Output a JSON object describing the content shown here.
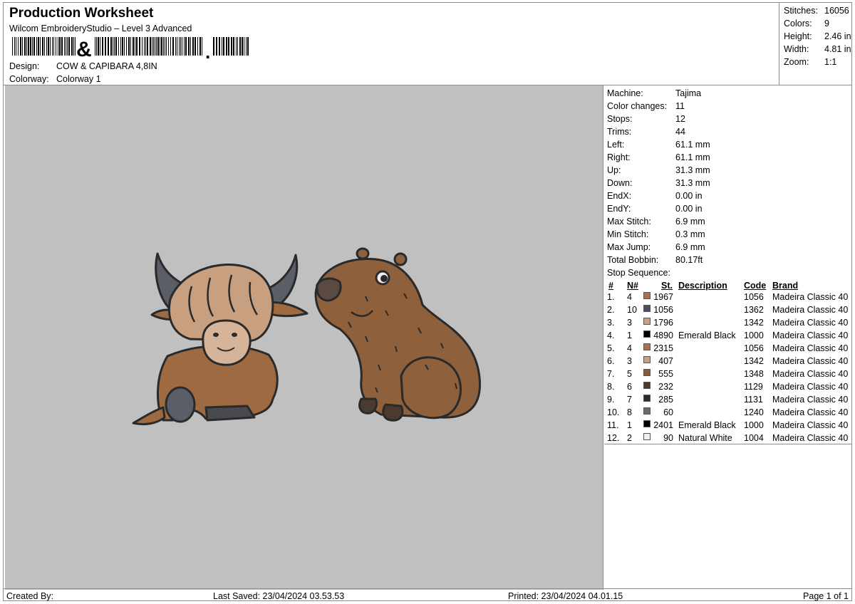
{
  "header": {
    "title": "Production Worksheet",
    "subtitle": "Wilcom EmbroideryStudio – Level 3 Advanced",
    "design_label": "Design:",
    "design_value": "COW  & CAPIBARA 4,8IN",
    "colorway_label": "Colorway:",
    "colorway_value": "Colorway 1"
  },
  "summary": [
    {
      "label": "Stitches:",
      "value": "16056"
    },
    {
      "label": "Colors:",
      "value": "9"
    },
    {
      "label": "Height:",
      "value": "2.46 in"
    },
    {
      "label": "Width:",
      "value": "4.81 in"
    },
    {
      "label": "Zoom:",
      "value": "1:1"
    }
  ],
  "machine_info": [
    {
      "label": "Machine:",
      "value": "Tajima"
    },
    {
      "label": "Color changes:",
      "value": "11"
    },
    {
      "label": "Stops:",
      "value": "12"
    },
    {
      "label": "Trims:",
      "value": "44"
    },
    {
      "label": "Left:",
      "value": "61.1 mm"
    },
    {
      "label": "Right:",
      "value": "61.1 mm"
    },
    {
      "label": "Up:",
      "value": "31.3 mm"
    },
    {
      "label": "Down:",
      "value": "31.3 mm"
    },
    {
      "label": "EndX:",
      "value": "0.00 in"
    },
    {
      "label": "EndY:",
      "value": "0.00 in"
    },
    {
      "label": "Max Stitch:",
      "value": "6.9 mm"
    },
    {
      "label": "Min Stitch:",
      "value": "0.3 mm"
    },
    {
      "label": "Max Jump:",
      "value": "6.9 mm"
    },
    {
      "label": "Total Bobbin:",
      "value": "80.17ft"
    }
  ],
  "stop_sequence": {
    "title": "Stop Sequence:",
    "columns": {
      "idx": "#",
      "needle": "N#",
      "stitches": "St.",
      "description": "Description",
      "code": "Code",
      "brand": "Brand"
    },
    "rows": [
      {
        "idx": "1.",
        "needle": "4",
        "color": "#a87050",
        "stitches": "1967",
        "description": "",
        "code": "1056",
        "brand": "Madeira Classic 40"
      },
      {
        "idx": "2.",
        "needle": "10",
        "color": "#4e4e5e",
        "stitches": "1056",
        "description": "",
        "code": "1362",
        "brand": "Madeira Classic 40"
      },
      {
        "idx": "3.",
        "needle": "3",
        "color": "#c8a08a",
        "stitches": "1796",
        "description": "",
        "code": "1342",
        "brand": "Madeira Classic 40"
      },
      {
        "idx": "4.",
        "needle": "1",
        "color": "#000000",
        "stitches": "4890",
        "description": "Emerald Black",
        "code": "1000",
        "brand": "Madeira Classic 40"
      },
      {
        "idx": "5.",
        "needle": "4",
        "color": "#a87050",
        "stitches": "2315",
        "description": "",
        "code": "1056",
        "brand": "Madeira Classic 40"
      },
      {
        "idx": "6.",
        "needle": "3",
        "color": "#c8a08a",
        "stitches": "407",
        "description": "",
        "code": "1342",
        "brand": "Madeira Classic 40"
      },
      {
        "idx": "7.",
        "needle": "5",
        "color": "#8a5a3a",
        "stitches": "555",
        "description": "",
        "code": "1348",
        "brand": "Madeira Classic 40"
      },
      {
        "idx": "8.",
        "needle": "6",
        "color": "#4a3a30",
        "stitches": "232",
        "description": "",
        "code": "1129",
        "brand": "Madeira Classic 40"
      },
      {
        "idx": "9.",
        "needle": "7",
        "color": "#2e2a28",
        "stitches": "285",
        "description": "",
        "code": "1131",
        "brand": "Madeira Classic 40"
      },
      {
        "idx": "10.",
        "needle": "8",
        "color": "#706868",
        "stitches": "60",
        "description": "",
        "code": "1240",
        "brand": "Madeira Classic 40"
      },
      {
        "idx": "11.",
        "needle": "1",
        "color": "#000000",
        "stitches": "2401",
        "description": "Emerald Black",
        "code": "1000",
        "brand": "Madeira Classic 40"
      },
      {
        "idx": "12.",
        "needle": "2",
        "color": "#f0f0f0",
        "stitches": "90",
        "description": "Natural White",
        "code": "1004",
        "brand": "Madeira Classic 40"
      }
    ]
  },
  "footer": {
    "created_by": "Created By:",
    "last_saved": "Last Saved: 23/04/2024 03.53.53",
    "printed": "Printed: 23/04/2024 04.01.15",
    "page": "Page 1 of 1"
  },
  "colors": {
    "canvas_bg": "#c0c0c0",
    "cow_body": "#9e6a42",
    "cow_hair": "#c8a080",
    "cow_horn": "#5a5e66",
    "capybara_body": "#8e603c",
    "outline": "#2a2a2a"
  }
}
